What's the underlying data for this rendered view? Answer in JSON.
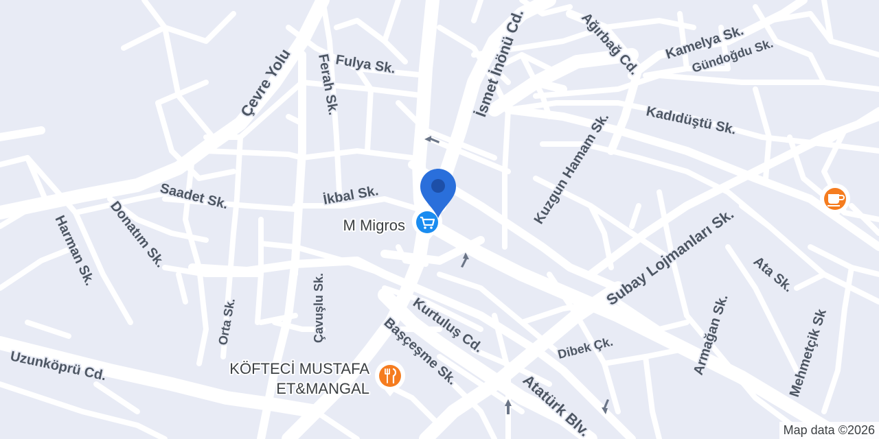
{
  "map": {
    "streets": {
      "cevre_yolu": "Çevre Yolu",
      "fulya": "Fulya Sk.",
      "ferah": "Ferah Sk.",
      "ismet_inonu": "İsmet İnönü Cd.",
      "agirbag": "Ağırbağ Cd.",
      "kamelya": "Kamelya Sk.",
      "gundogdu": "Gündoğdu Sk.",
      "kadiduştu": "Kadıdüştü Sk.",
      "kuzgun_hamam": "Kuzgun Hamam Sk.",
      "ikbal": "İkbal Sk.",
      "saadet": "Saadet Sk.",
      "donatim": "Donatım Sk.",
      "harman": "Harman Sk.",
      "cavuslu": "Çavuşlu Sk.",
      "orta": "Orta Sk.",
      "subay": "Subay Lojmanları Sk.",
      "ata": "Ata Sk.",
      "mehmetcik": "Mehmetçik Sk",
      "armagan": "Armağan Sk.",
      "kurtulus": "Kurtuluş Cd.",
      "bascesme": "Başçeşme Sk.",
      "dibek": "Dibek Çk.",
      "ataturk": "Atatürk Blv.",
      "uzunkopru": "Uzunköprü Cd."
    },
    "places": {
      "migros": {
        "name": "M Migros",
        "icon": "shopping-cart-icon",
        "color": "#1a8cf0"
      },
      "kofteci_line1": "KÖFTECİ MUSTAFA",
      "kofteci_line2": "ET&MANGAL",
      "kofteci": {
        "icon": "restaurant-icon",
        "color": "#f57c1f"
      },
      "cafe": {
        "icon": "coffee-cup-icon",
        "color": "#f57c1f"
      }
    },
    "pin": {
      "icon": "location-pin-icon",
      "color": "#2a6fdb"
    },
    "colors": {
      "background": "#e8ebf5",
      "road": "#ffffff",
      "label": "#4d5663"
    }
  },
  "attribution": "Map data ©2026"
}
